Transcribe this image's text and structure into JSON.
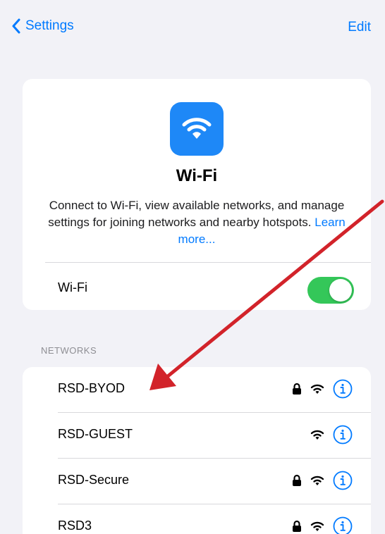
{
  "nav": {
    "back_label": "Settings",
    "edit_label": "Edit"
  },
  "hero": {
    "title": "Wi-Fi",
    "description": "Connect to Wi-Fi, view available networks, and manage settings for joining networks and nearby hotspots.",
    "learn_more": "Learn more..."
  },
  "wifi_toggle": {
    "label": "Wi-Fi",
    "on": true
  },
  "networks": {
    "header": "NETWORKS",
    "items": [
      {
        "name": "RSD-BYOD",
        "locked": true
      },
      {
        "name": "RSD-GUEST",
        "locked": false
      },
      {
        "name": "RSD-Secure",
        "locked": true
      },
      {
        "name": "RSD3",
        "locked": true
      }
    ]
  },
  "colors": {
    "accent": "#007aff",
    "toggle_on": "#34c759",
    "wifi_icon_bg": "#1e88f7",
    "annotation_arrow": "#d2232a"
  }
}
